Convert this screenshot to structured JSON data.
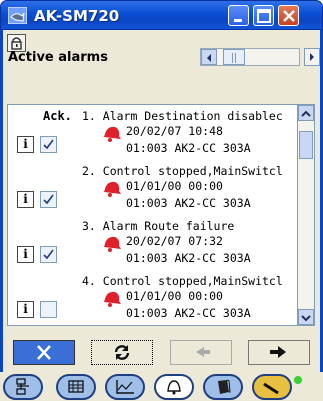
{
  "window": {
    "title": "AK-SM720"
  },
  "header": {
    "title": "Active alarms"
  },
  "list": {
    "ack_label": "Ack.",
    "alarms": [
      {
        "line1": "1. Alarm Destination disablec",
        "date": "20/02/07 10:48",
        "address": "01:003 AK2-CC 303A",
        "acknowledged": true
      },
      {
        "line1": "2. Control stopped,MainSwitcl",
        "date": "01/01/00 00:00",
        "address": "01:003 AK2-CC 303A",
        "acknowledged": true
      },
      {
        "line1": "3. Alarm Route failure",
        "date": "20/02/07 07:32",
        "address": "01:003 AK2-CC 303A",
        "acknowledged": true
      },
      {
        "line1": "4. Control stopped,MainSwitcl",
        "date": "01/01/00 00:00",
        "address": "01:003 AK2-CC 303A",
        "acknowledged": false
      }
    ],
    "info_label": "i"
  },
  "colors": {
    "bell": "#e0202a",
    "titlebar": "#0a46c4",
    "accent_blue": "#3a6fd8"
  }
}
